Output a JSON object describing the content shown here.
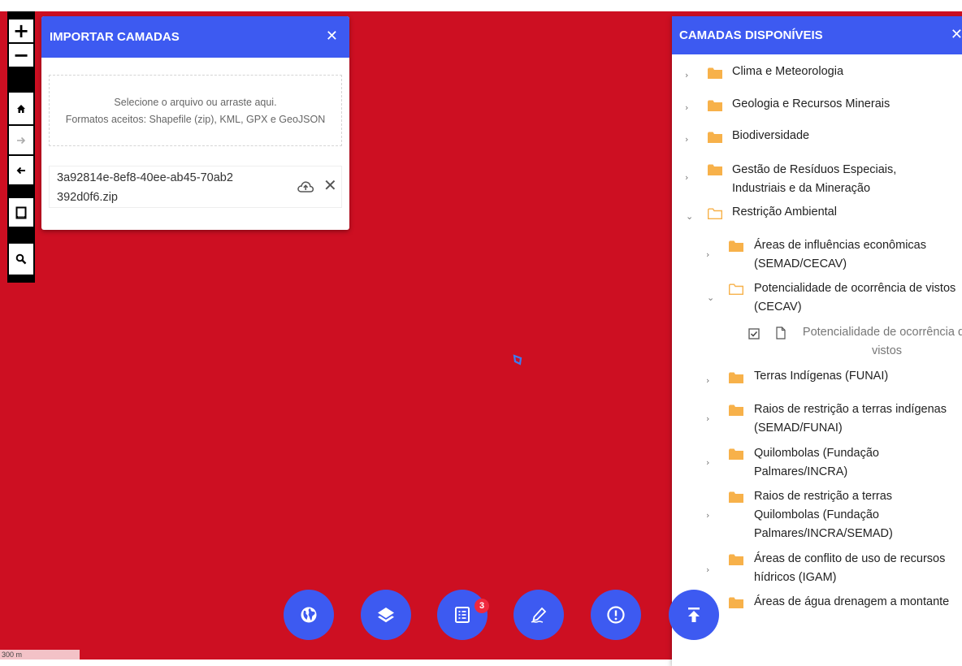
{
  "colors": {
    "map_background": "#cd0f22",
    "accent": "#3d5af1",
    "badge": "#f0293e"
  },
  "toolbar": {
    "zoom_in": "+",
    "zoom_out": "−",
    "home": "home-icon",
    "forward": "arrow-right-icon",
    "back": "arrow-left-icon",
    "measure": "ruler-icon",
    "search": "search-icon"
  },
  "import_panel": {
    "title": "IMPORTAR CAMADAS",
    "close": "✕",
    "dropzone_line1": "Selecione o arquivo ou arraste aqui.",
    "dropzone_line2": "Formatos aceitos: Shapefile (zip), KML, GPX e GeoJSON",
    "file_name": "3a92814e-8ef8-40ee-ab45-70ab2392d0f6.zip",
    "remove": "✕"
  },
  "layers_panel": {
    "title": "CAMADAS DISPONÍVEIS",
    "close": "✕",
    "items": [
      {
        "label": "Clima e Meteorologia",
        "level": 0,
        "expanded": false
      },
      {
        "label": "Geologia e Recursos Minerais",
        "level": 0,
        "expanded": false
      },
      {
        "label": "Biodiversidade",
        "level": 0,
        "expanded": false
      },
      {
        "label": "Gestão de Resíduos Especiais, Industriais e da Mineração",
        "level": 0,
        "expanded": false
      },
      {
        "label": "Restrição Ambiental",
        "level": 0,
        "expanded": true
      },
      {
        "label": "Áreas de influências econômicas (SEMAD/CECAV)",
        "level": 1,
        "expanded": false
      },
      {
        "label": "Potencialidade de ocorrência de vistos (CECAV)",
        "level": 1,
        "expanded": true
      },
      {
        "label": "Potencialidade de ocorrência de vistos",
        "level": 2,
        "checked": true
      },
      {
        "label": "Terras Indígenas (FUNAI)",
        "level": 1,
        "expanded": false
      },
      {
        "label": "Raios de restrição a terras indígenas (SEMAD/FUNAI)",
        "level": 1,
        "expanded": false
      },
      {
        "label": "Quilombolas (Fundação Palmares/INCRA)",
        "level": 1,
        "expanded": false
      },
      {
        "label": "Raios de restrição a terras Quilombolas (Fundação Palmares/INCRA/SEMAD)",
        "level": 1,
        "expanded": false
      },
      {
        "label": "Áreas de conflito de uso de recursos hídricos (IGAM)",
        "level": 1,
        "expanded": false
      },
      {
        "label": "Áreas de água drenagem a montante",
        "level": 1,
        "expanded": false
      }
    ]
  },
  "bottom_bar": {
    "buttons": [
      "globe-icon",
      "layers-icon",
      "legend-icon",
      "draw-icon",
      "info-icon",
      "upload-icon"
    ],
    "badge_count": "3"
  },
  "scale": "300 m"
}
